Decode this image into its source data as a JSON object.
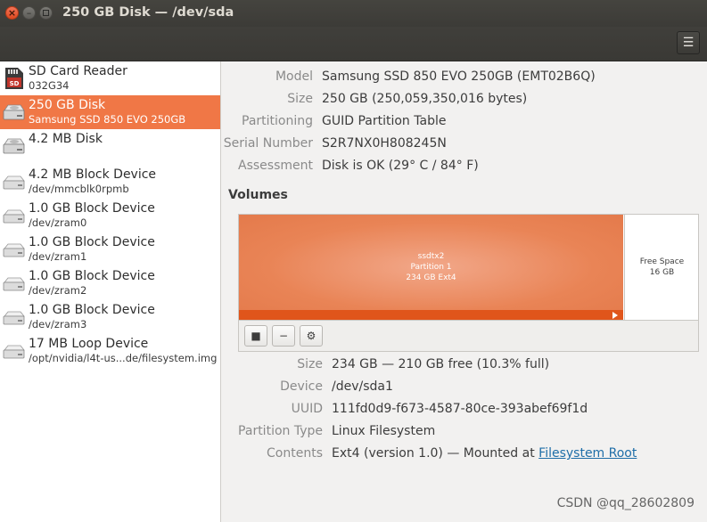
{
  "window": {
    "title": "250 GB Disk — /dev/sda"
  },
  "devices": [
    {
      "name": "SD Card Reader",
      "sub": "032G34",
      "icon": "sd-card-icon",
      "selected": false
    },
    {
      "name": "250 GB Disk",
      "sub": "Samsung SSD 850 EVO 250GB",
      "icon": "hard-disk-icon",
      "selected": true
    },
    {
      "name": "4.2 MB Disk",
      "sub": "",
      "icon": "hard-disk-icon",
      "selected": false
    },
    {
      "name": "4.2 MB Block Device",
      "sub": "/dev/mmcblk0rpmb",
      "icon": "block-device-icon",
      "selected": false
    },
    {
      "name": "1.0 GB Block Device",
      "sub": "/dev/zram0",
      "icon": "block-device-icon",
      "selected": false
    },
    {
      "name": "1.0 GB Block Device",
      "sub": "/dev/zram1",
      "icon": "block-device-icon",
      "selected": false
    },
    {
      "name": "1.0 GB Block Device",
      "sub": "/dev/zram2",
      "icon": "block-device-icon",
      "selected": false
    },
    {
      "name": "1.0 GB Block Device",
      "sub": "/dev/zram3",
      "icon": "block-device-icon",
      "selected": false
    },
    {
      "name": "17 MB Loop Device",
      "sub": "/opt/nvidia/l4t-us...de/filesystem.img",
      "icon": "block-device-icon",
      "selected": false
    }
  ],
  "disk": {
    "model_label": "Model",
    "model": "Samsung SSD 850 EVO 250GB (EMT02B6Q)",
    "size_label": "Size",
    "size": "250 GB (250,059,350,016 bytes)",
    "partitioning_label": "Partitioning",
    "partitioning": "GUID Partition Table",
    "serial_label": "Serial Number",
    "serial": "S2R7NX0H808245N",
    "assessment_label": "Assessment",
    "assessment": "Disk is OK (29° C / 84° F)"
  },
  "volumes": {
    "heading": "Volumes",
    "partition": {
      "line1": "ssdtx2",
      "line2": "Partition 1",
      "line3": "234 GB Ext4"
    },
    "free": {
      "line1": "Free Space",
      "line2": "16 GB"
    }
  },
  "volume_details": {
    "size_label": "Size",
    "size": "234 GB — 210 GB free (10.3% full)",
    "device_label": "Device",
    "device": "/dev/sda1",
    "uuid_label": "UUID",
    "uuid": "111fd0d9-f673-4587-80ce-393abef69f1d",
    "type_label": "Partition Type",
    "type": "Linux Filesystem",
    "contents_label": "Contents",
    "contents_prefix": "Ext4 (version 1.0) — Mounted at ",
    "contents_link": "Filesystem Root"
  },
  "watermark": "CSDN @qq_28602809",
  "colors": {
    "accent": "#f07746",
    "partition": "#e98456",
    "partition_bar": "#e0551b",
    "titlebar": "#3c3b37"
  }
}
